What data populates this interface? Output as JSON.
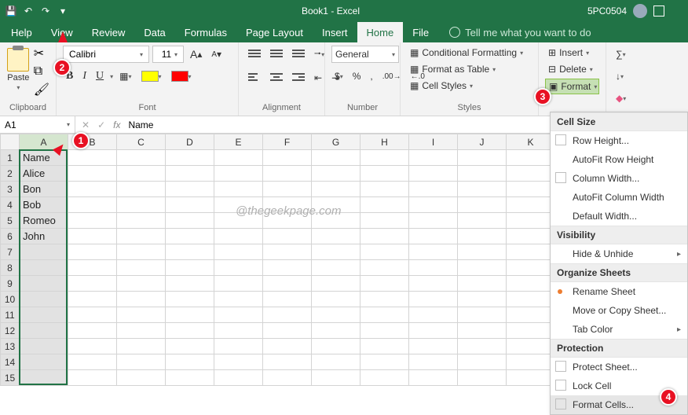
{
  "titlebar": {
    "document_name": "Book1",
    "app_name": "Excel",
    "separator": "  -  ",
    "account": "5PC0504"
  },
  "menu": {
    "items": [
      "File",
      "Home",
      "Insert",
      "Page Layout",
      "Formulas",
      "Data",
      "Review",
      "View",
      "Help"
    ],
    "active_index": 1,
    "tell_me": "Tell me what you want to do"
  },
  "ribbon": {
    "clipboard": {
      "label": "Clipboard",
      "paste": "Paste"
    },
    "font": {
      "label": "Font",
      "name": "Calibri",
      "size": "11",
      "increase_tip": "A",
      "decrease_tip": "A",
      "bold": "B",
      "italic": "I",
      "underline": "U"
    },
    "alignment": {
      "label": "Alignment"
    },
    "number": {
      "label": "Number",
      "format": "General"
    },
    "styles": {
      "label": "Styles",
      "conditional": "Conditional Formatting",
      "table": "Format as Table",
      "cell_styles": "Cell Styles"
    },
    "cells": {
      "insert": "Insert",
      "delete": "Delete",
      "format": "Format"
    }
  },
  "formula_bar": {
    "cell_ref": "A1",
    "value": "Name"
  },
  "grid": {
    "columns": [
      "A",
      "B",
      "C",
      "D",
      "E",
      "F",
      "G",
      "H",
      "I",
      "J",
      "K"
    ],
    "rows": [
      {
        "n": "1",
        "a": "Name"
      },
      {
        "n": "2",
        "a": "Alice"
      },
      {
        "n": "3",
        "a": "Bon"
      },
      {
        "n": "4",
        "a": "Bob"
      },
      {
        "n": "5",
        "a": "Romeo"
      },
      {
        "n": "6",
        "a": "John"
      },
      {
        "n": "7",
        "a": ""
      },
      {
        "n": "8",
        "a": ""
      },
      {
        "n": "9",
        "a": ""
      },
      {
        "n": "10",
        "a": ""
      },
      {
        "n": "11",
        "a": ""
      },
      {
        "n": "12",
        "a": ""
      },
      {
        "n": "13",
        "a": ""
      },
      {
        "n": "14",
        "a": ""
      },
      {
        "n": "15",
        "a": ""
      }
    ],
    "selected_column": "A"
  },
  "format_menu": {
    "sections": [
      {
        "title": "Cell Size",
        "items": [
          {
            "label": "Row Height...",
            "icon": true
          },
          {
            "label": "AutoFit Row Height",
            "icon": false
          },
          {
            "label": "Column Width...",
            "icon": true
          },
          {
            "label": "AutoFit Column Width",
            "icon": false
          },
          {
            "label": "Default Width...",
            "icon": false
          }
        ]
      },
      {
        "title": "Visibility",
        "items": [
          {
            "label": "Hide & Unhide",
            "icon": false,
            "submenu": true
          }
        ]
      },
      {
        "title": "Organize Sheets",
        "items": [
          {
            "label": "Rename Sheet",
            "icon": false,
            "bullet": true
          },
          {
            "label": "Move or Copy Sheet...",
            "icon": false
          },
          {
            "label": "Tab Color",
            "icon": false,
            "submenu": true
          }
        ]
      },
      {
        "title": "Protection",
        "items": [
          {
            "label": "Protect Sheet...",
            "icon": true
          },
          {
            "label": "Lock Cell",
            "icon": true
          },
          {
            "label": "Format Cells...",
            "icon": true,
            "selected": true
          }
        ]
      }
    ]
  },
  "callouts": {
    "c1": "1",
    "c2": "2",
    "c3": "3",
    "c4": "4"
  },
  "watermark": "@thegeekpage.com"
}
